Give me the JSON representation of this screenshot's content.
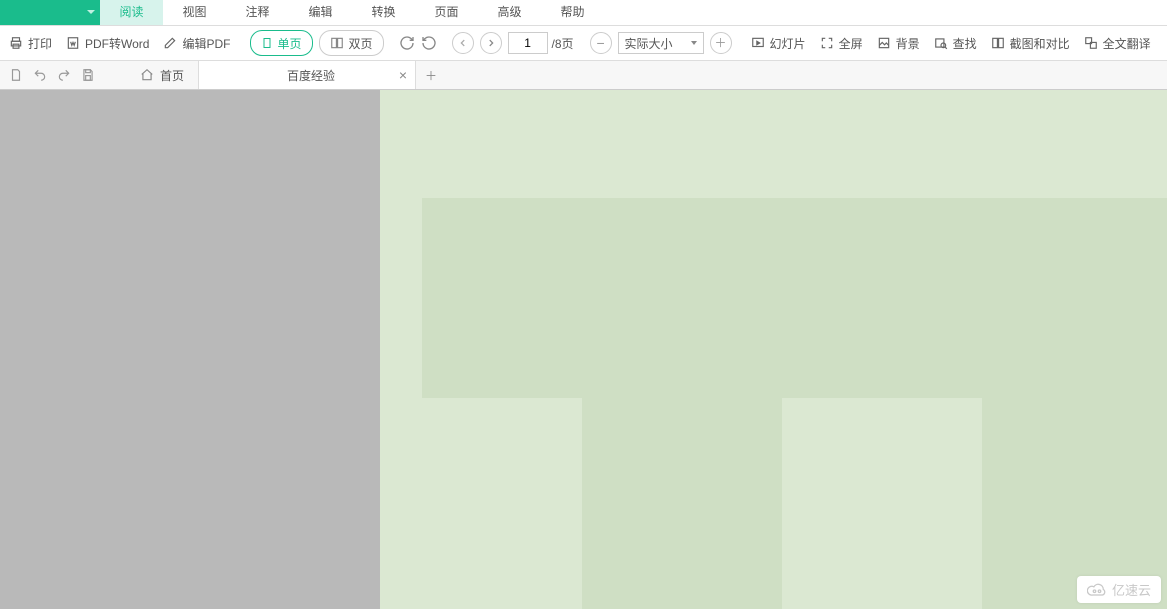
{
  "menu": {
    "items": [
      "阅读",
      "视图",
      "注释",
      "编辑",
      "转换",
      "页面",
      "高级",
      "帮助"
    ],
    "activeIndex": 0
  },
  "toolbar": {
    "print": "打印",
    "pdf_to_word": "PDF转Word",
    "edit_pdf": "编辑PDF",
    "single_page": "单页",
    "double_page": "双页",
    "page_current": "1",
    "page_total": "/8页",
    "zoom_label": "实际大小",
    "slideshow": "幻灯片",
    "fullscreen": "全屏",
    "background": "背景",
    "find": "查找",
    "screenshot_compare": "截图和对比",
    "full_translate": "全文翻译"
  },
  "tabs": {
    "home": "首页",
    "doc": "百度经验"
  },
  "watermark": "亿速云"
}
